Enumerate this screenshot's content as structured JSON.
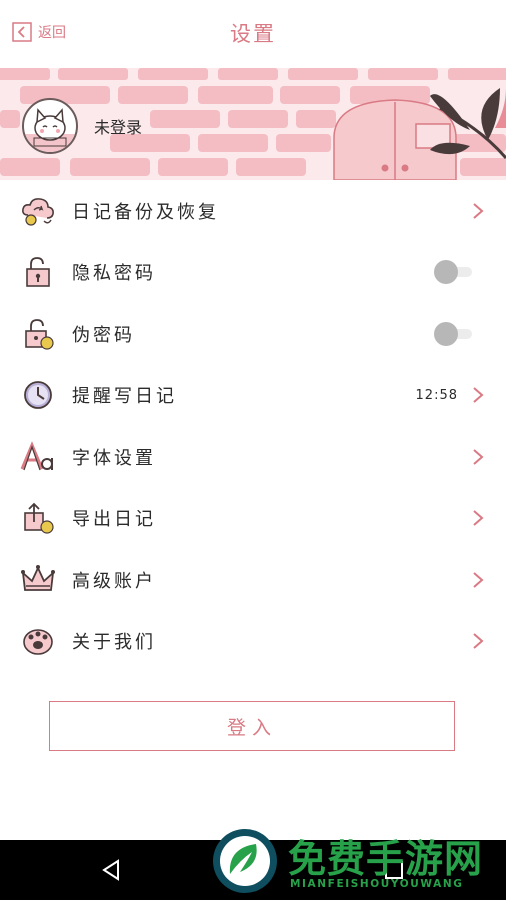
{
  "header": {
    "back_label": "返回",
    "title": "设置"
  },
  "profile": {
    "status": "未登录"
  },
  "settings": {
    "items": [
      {
        "label": "日记备份及恢复",
        "icon": "cloud-sync-icon",
        "type": "link"
      },
      {
        "label": "隐私密码",
        "icon": "lock-icon",
        "type": "toggle",
        "on": false
      },
      {
        "label": "伪密码",
        "icon": "fake-lock-icon",
        "type": "toggle",
        "on": false
      },
      {
        "label": "提醒写日记",
        "icon": "clock-icon",
        "type": "link",
        "value": "12:58"
      },
      {
        "label": "字体设置",
        "icon": "font-icon",
        "type": "link"
      },
      {
        "label": "导出日记",
        "icon": "export-icon",
        "type": "link"
      },
      {
        "label": "高级账户",
        "icon": "crown-icon",
        "type": "link"
      },
      {
        "label": "关于我们",
        "icon": "paw-icon",
        "type": "link"
      }
    ]
  },
  "login_button": "登入",
  "watermark": {
    "title": "免费手游网",
    "subtitle": "MIANFEISHOUYOUWANG"
  },
  "colors": {
    "accent": "#d97a84",
    "banner": "#fbe9eb",
    "brick": "#f2b6bd",
    "watermark": "#27a24a"
  }
}
